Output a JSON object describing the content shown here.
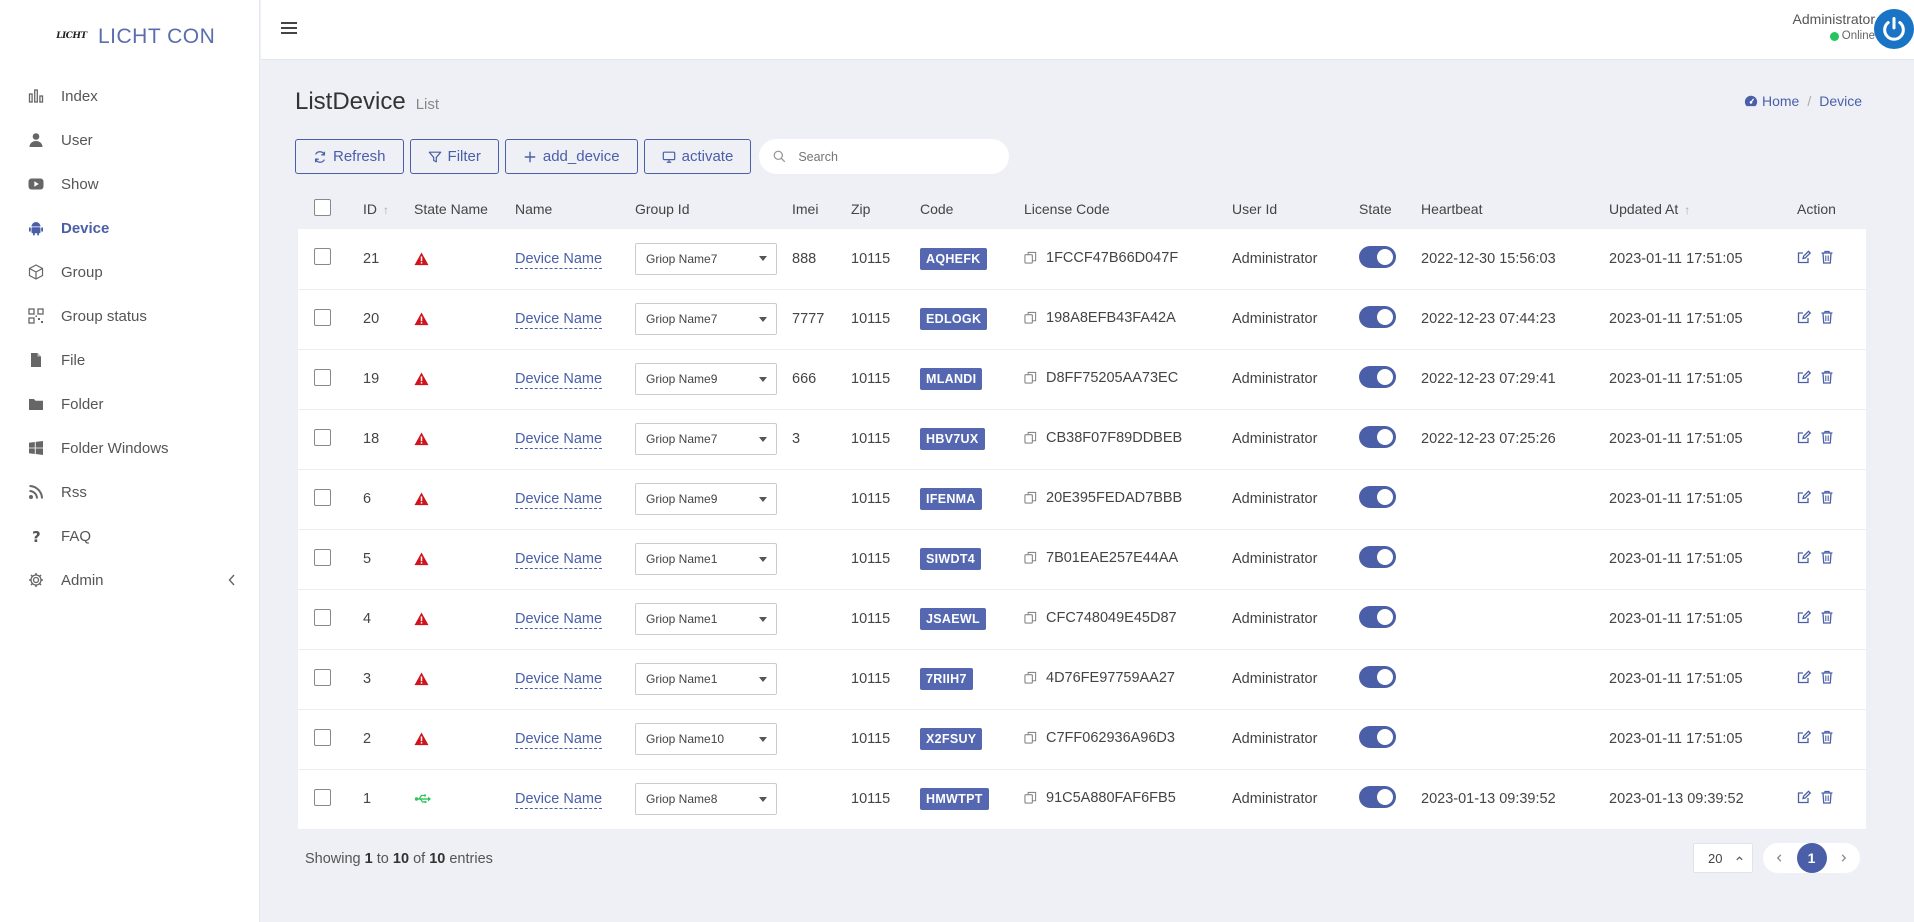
{
  "brand": {
    "logo_text": "LICHT",
    "name": "LICHT CON"
  },
  "sidebar": {
    "items": [
      {
        "label": "Index",
        "icon": "bar-chart-icon",
        "active": false
      },
      {
        "label": "User",
        "icon": "user-icon",
        "active": false
      },
      {
        "label": "Show",
        "icon": "youtube-icon",
        "active": false
      },
      {
        "label": "Device",
        "icon": "android-icon",
        "active": true
      },
      {
        "label": "Group",
        "icon": "cube-icon",
        "active": false
      },
      {
        "label": "Group status",
        "icon": "qrcode-icon",
        "active": false
      },
      {
        "label": "File",
        "icon": "file-icon",
        "active": false
      },
      {
        "label": "Folder",
        "icon": "folder-icon",
        "active": false
      },
      {
        "label": "Folder Windows",
        "icon": "windows-icon",
        "active": false
      },
      {
        "label": "Rss",
        "icon": "rss-icon",
        "active": false
      },
      {
        "label": "FAQ",
        "icon": "question-icon",
        "active": false
      },
      {
        "label": "Admin",
        "icon": "gear-icon",
        "active": false
      }
    ]
  },
  "header": {
    "user_name": "Administrator",
    "status": "Online"
  },
  "page": {
    "title": "ListDevice",
    "subtitle": "List"
  },
  "breadcrumb": {
    "home": "Home",
    "current": "Device"
  },
  "toolbar": {
    "refresh": "Refresh",
    "filter": "Filter",
    "add_device": "add_device",
    "activate": "activate",
    "search_placeholder": "Search"
  },
  "table": {
    "headers": {
      "id": "ID",
      "state_name": "State Name",
      "name": "Name",
      "group_id": "Group Id",
      "imei": "Imei",
      "zip": "Zip",
      "code": "Code",
      "license_code": "License Code",
      "user_id": "User Id",
      "state": "State",
      "heartbeat": "Heartbeat",
      "updated_at": "Updated At",
      "action": "Action"
    },
    "rows": [
      {
        "id": "21",
        "state_icon": "warning-icon",
        "name": "Device Name",
        "group": "Griop Name7",
        "imei": "888",
        "zip": "10115",
        "code": "AQHEFK",
        "license": "1FCCF47B66D047F",
        "user": "Administrator",
        "heartbeat": "2022-12-30 15:56:03",
        "updated": "2023-01-11 17:51:05"
      },
      {
        "id": "20",
        "state_icon": "warning-icon",
        "name": "Device Name",
        "group": "Griop Name7",
        "imei": "7777",
        "zip": "10115",
        "code": "EDLOGK",
        "license": "198A8EFB43FA42A",
        "user": "Administrator",
        "heartbeat": "2022-12-23 07:44:23",
        "updated": "2023-01-11 17:51:05"
      },
      {
        "id": "19",
        "state_icon": "warning-icon",
        "name": "Device Name",
        "group": "Griop Name9",
        "imei": "666",
        "zip": "10115",
        "code": "MLANDI",
        "license": "D8FF75205AA73EC",
        "user": "Administrator",
        "heartbeat": "2022-12-23 07:29:41",
        "updated": "2023-01-11 17:51:05"
      },
      {
        "id": "18",
        "state_icon": "warning-icon",
        "name": "Device Name",
        "group": "Griop Name7",
        "imei": "3",
        "zip": "10115",
        "code": "HBV7UX",
        "license": "CB38F07F89DDBEB",
        "user": "Administrator",
        "heartbeat": "2022-12-23 07:25:26",
        "updated": "2023-01-11 17:51:05"
      },
      {
        "id": "6",
        "state_icon": "warning-icon",
        "name": "Device Name",
        "group": "Griop Name9",
        "imei": "",
        "zip": "10115",
        "code": "IFENMA",
        "license": "20E395FEDAD7BBB",
        "user": "Administrator",
        "heartbeat": "",
        "updated": "2023-01-11 17:51:05"
      },
      {
        "id": "5",
        "state_icon": "warning-icon",
        "name": "Device Name",
        "group": "Griop Name1",
        "imei": "",
        "zip": "10115",
        "code": "SIWDT4",
        "license": "7B01EAE257E44AA",
        "user": "Administrator",
        "heartbeat": "",
        "updated": "2023-01-11 17:51:05"
      },
      {
        "id": "4",
        "state_icon": "warning-icon",
        "name": "Device Name",
        "group": "Griop Name1",
        "imei": "",
        "zip": "10115",
        "code": "JSAEWL",
        "license": "CFC748049E45D87",
        "user": "Administrator",
        "heartbeat": "",
        "updated": "2023-01-11 17:51:05"
      },
      {
        "id": "3",
        "state_icon": "warning-icon",
        "name": "Device Name",
        "group": "Griop Name1",
        "imei": "",
        "zip": "10115",
        "code": "7RIIH7",
        "license": "4D76FE97759AA27",
        "user": "Administrator",
        "heartbeat": "",
        "updated": "2023-01-11 17:51:05"
      },
      {
        "id": "2",
        "state_icon": "warning-icon",
        "name": "Device Name",
        "group": "Griop Name10",
        "imei": "",
        "zip": "10115",
        "code": "X2FSUY",
        "license": "C7FF062936A96D3",
        "user": "Administrator",
        "heartbeat": "",
        "updated": "2023-01-11 17:51:05"
      },
      {
        "id": "1",
        "state_icon": "usb-icon",
        "name": "Device Name",
        "group": "Griop Name8",
        "imei": "",
        "zip": "10115",
        "code": "HMWTPT",
        "license": "91C5A880FAF6FB5",
        "user": "Administrator",
        "heartbeat": "2023-01-13 09:39:52",
        "updated": "2023-01-13 09:39:52"
      }
    ]
  },
  "footer": {
    "showing": "Showing",
    "from": "1",
    "to_word": "to",
    "to": "10",
    "of_word": "of",
    "total": "10",
    "entries": "entries",
    "page_size": "20",
    "current_page": "1"
  },
  "colors": {
    "accent": "#4a5fa8",
    "badge": "#5467b0",
    "warning": "#d0141d",
    "online": "#22c55e",
    "usb": "#2ec55a",
    "power": "#1a74c5"
  }
}
